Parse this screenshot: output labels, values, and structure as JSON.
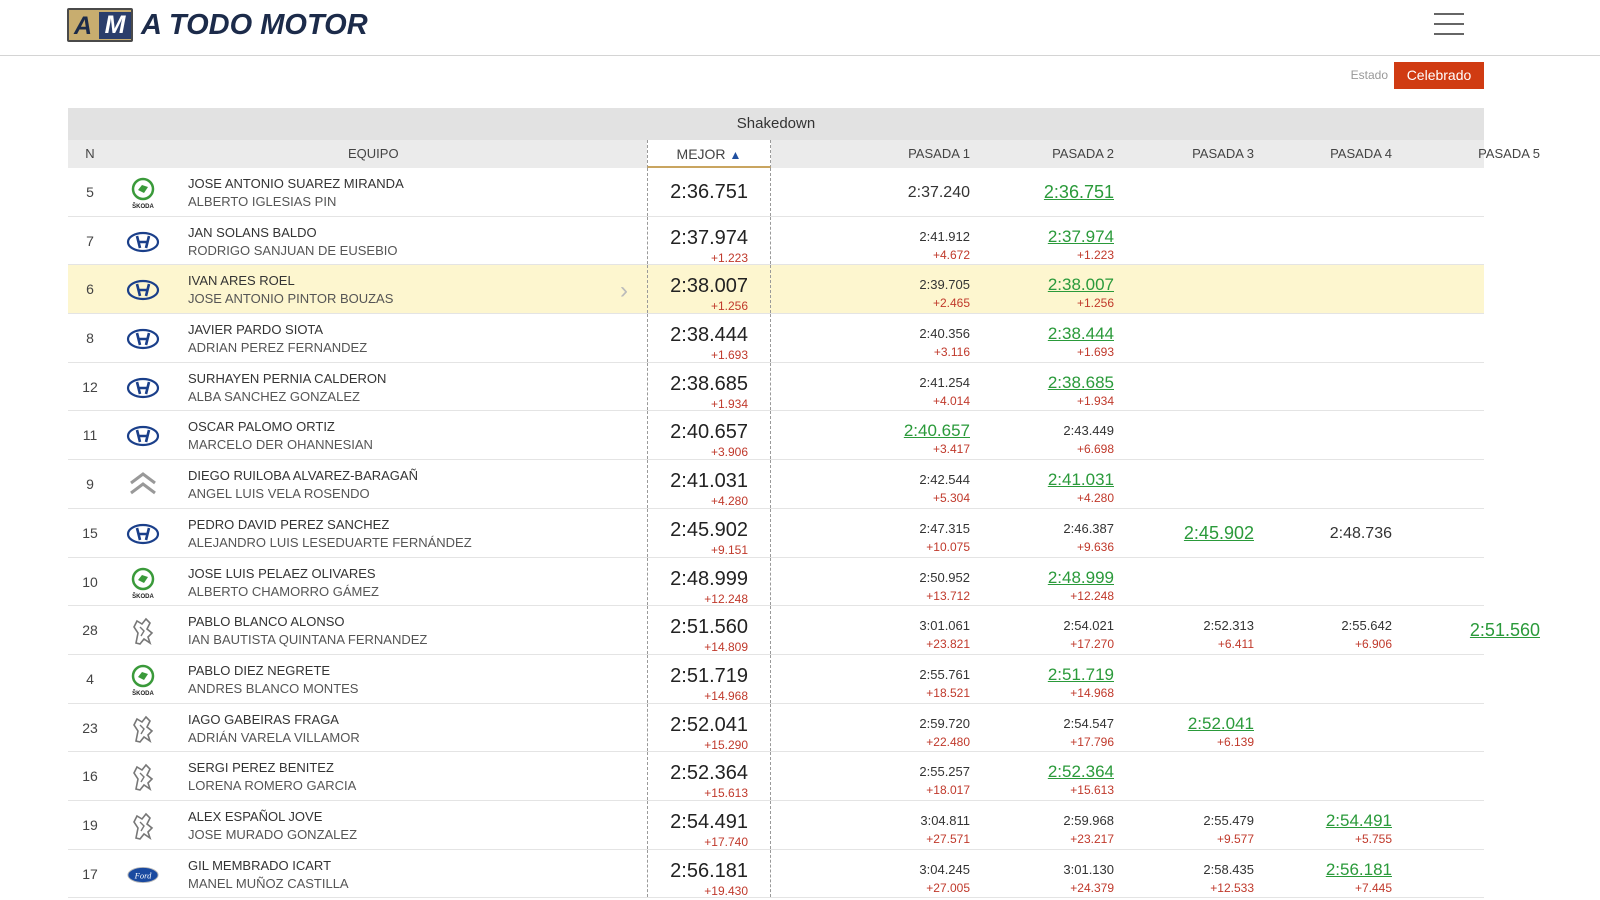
{
  "site": {
    "title": "A TODO MOTOR",
    "badge_a": "A",
    "badge_m": "M"
  },
  "estado": {
    "label": "Estado",
    "value": "Celebrado"
  },
  "section_title": "Shakedown",
  "columns": {
    "n": "N",
    "equipo": "EQUIPO",
    "mejor": "MEJOR",
    "sort_icon": "▲",
    "p1": "PASADA 1",
    "p2": "PASADA 2",
    "p3": "PASADA 3",
    "p4": "PASADA 4",
    "p5": "PASADA 5"
  },
  "brand_colors": {
    "skoda": "#3a9a3a",
    "hyundai": "#1a3f8a",
    "citroen": "#888888",
    "peugeot": "#777777",
    "ford": "#1a4aa0"
  },
  "rows": [
    {
      "n": "5",
      "brand": "skoda-icon",
      "driver": "JOSE ANTONIO SUAREZ MIRANDA",
      "codriver": "ALBERTO IGLESIAS PIN",
      "best": "2:36.751",
      "best_gap": "",
      "p1": {
        "t": "2:37.240",
        "g": ""
      },
      "p2": {
        "t": "2:36.751",
        "g": ""
      },
      "p3": {
        "t": "",
        "g": ""
      },
      "p4": {
        "t": "",
        "g": ""
      },
      "p5": {
        "t": "",
        "g": ""
      }
    },
    {
      "n": "7",
      "brand": "hyundai-icon",
      "driver": "JAN SOLANS BALDO",
      "codriver": "RODRIGO SANJUAN DE EUSEBIO",
      "best": "2:37.974",
      "best_gap": "+1.223",
      "p1": {
        "t": "2:41.912",
        "g": "+4.672"
      },
      "p2": {
        "t": "2:37.974",
        "g": "+1.223"
      },
      "p3": {
        "t": "",
        "g": ""
      },
      "p4": {
        "t": "",
        "g": ""
      },
      "p5": {
        "t": "",
        "g": ""
      }
    },
    {
      "n": "6",
      "brand": "hyundai-icon",
      "driver": "IVAN ARES ROEL",
      "codriver": "JOSE ANTONIO PINTOR BOUZAS",
      "best": "2:38.007",
      "best_gap": "+1.256",
      "p1": {
        "t": "2:39.705",
        "g": "+2.465"
      },
      "p2": {
        "t": "2:38.007",
        "g": "+1.256"
      },
      "p3": {
        "t": "",
        "g": ""
      },
      "p4": {
        "t": "",
        "g": ""
      },
      "p5": {
        "t": "",
        "g": ""
      }
    },
    {
      "n": "8",
      "brand": "hyundai-icon",
      "driver": "JAVIER PARDO SIOTA",
      "codriver": "ADRIAN PEREZ FERNANDEZ",
      "best": "2:38.444",
      "best_gap": "+1.693",
      "p1": {
        "t": "2:40.356",
        "g": "+3.116"
      },
      "p2": {
        "t": "2:38.444",
        "g": "+1.693"
      },
      "p3": {
        "t": "",
        "g": ""
      },
      "p4": {
        "t": "",
        "g": ""
      },
      "p5": {
        "t": "",
        "g": ""
      }
    },
    {
      "n": "12",
      "brand": "hyundai-icon",
      "driver": "SURHAYEN PERNIA CALDERON",
      "codriver": "ALBA SANCHEZ GONZALEZ",
      "best": "2:38.685",
      "best_gap": "+1.934",
      "p1": {
        "t": "2:41.254",
        "g": "+4.014"
      },
      "p2": {
        "t": "2:38.685",
        "g": "+1.934"
      },
      "p3": {
        "t": "",
        "g": ""
      },
      "p4": {
        "t": "",
        "g": ""
      },
      "p5": {
        "t": "",
        "g": ""
      }
    },
    {
      "n": "11",
      "brand": "hyundai-icon",
      "driver": "OSCAR PALOMO ORTIZ",
      "codriver": "MARCELO DER OHANNESIAN",
      "best": "2:40.657",
      "best_gap": "+3.906",
      "p1": {
        "t": "2:40.657",
        "g": "+3.417"
      },
      "p2": {
        "t": "2:43.449",
        "g": "+6.698"
      },
      "p3": {
        "t": "",
        "g": ""
      },
      "p4": {
        "t": "",
        "g": ""
      },
      "p5": {
        "t": "",
        "g": ""
      }
    },
    {
      "n": "9",
      "brand": "citroen-icon",
      "driver": "DIEGO RUILOBA ALVAREZ-BARAGAÑ",
      "codriver": "ANGEL LUIS VELA ROSENDO",
      "best": "2:41.031",
      "best_gap": "+4.280",
      "p1": {
        "t": "2:42.544",
        "g": "+5.304"
      },
      "p2": {
        "t": "2:41.031",
        "g": "+4.280"
      },
      "p3": {
        "t": "",
        "g": ""
      },
      "p4": {
        "t": "",
        "g": ""
      },
      "p5": {
        "t": "",
        "g": ""
      }
    },
    {
      "n": "15",
      "brand": "hyundai-icon",
      "driver": "PEDRO DAVID PEREZ SANCHEZ",
      "codriver": "ALEJANDRO LUIS LESEDUARTE FERNÁNDEZ",
      "best": "2:45.902",
      "best_gap": "+9.151",
      "p1": {
        "t": "2:47.315",
        "g": "+10.075"
      },
      "p2": {
        "t": "2:46.387",
        "g": "+9.636"
      },
      "p3": {
        "t": "2:45.902",
        "g": ""
      },
      "p4": {
        "t": "2:48.736",
        "g": ""
      },
      "p5": {
        "t": "",
        "g": ""
      }
    },
    {
      "n": "10",
      "brand": "skoda-icon",
      "driver": "JOSE LUIS PELAEZ OLIVARES",
      "codriver": "ALBERTO CHAMORRO GÁMEZ",
      "best": "2:48.999",
      "best_gap": "+12.248",
      "p1": {
        "t": "2:50.952",
        "g": "+13.712"
      },
      "p2": {
        "t": "2:48.999",
        "g": "+12.248"
      },
      "p3": {
        "t": "",
        "g": ""
      },
      "p4": {
        "t": "",
        "g": ""
      },
      "p5": {
        "t": "",
        "g": ""
      }
    },
    {
      "n": "28",
      "brand": "peugeot-icon",
      "driver": "PABLO BLANCO ALONSO",
      "codriver": "IAN BAUTISTA QUINTANA FERNANDEZ",
      "best": "2:51.560",
      "best_gap": "+14.809",
      "p1": {
        "t": "3:01.061",
        "g": "+23.821"
      },
      "p2": {
        "t": "2:54.021",
        "g": "+17.270"
      },
      "p3": {
        "t": "2:52.313",
        "g": "+6.411"
      },
      "p4": {
        "t": "2:55.642",
        "g": "+6.906"
      },
      "p5": {
        "t": "2:51.560",
        "g": ""
      }
    },
    {
      "n": "4",
      "brand": "skoda-icon",
      "driver": "PABLO DIEZ NEGRETE",
      "codriver": "ANDRES BLANCO MONTES",
      "best": "2:51.719",
      "best_gap": "+14.968",
      "p1": {
        "t": "2:55.761",
        "g": "+18.521"
      },
      "p2": {
        "t": "2:51.719",
        "g": "+14.968"
      },
      "p3": {
        "t": "",
        "g": ""
      },
      "p4": {
        "t": "",
        "g": ""
      },
      "p5": {
        "t": "",
        "g": ""
      }
    },
    {
      "n": "23",
      "brand": "peugeot-icon",
      "driver": "IAGO GABEIRAS FRAGA",
      "codriver": "ADRIÁN VARELA VILLAMOR",
      "best": "2:52.041",
      "best_gap": "+15.290",
      "p1": {
        "t": "2:59.720",
        "g": "+22.480"
      },
      "p2": {
        "t": "2:54.547",
        "g": "+17.796"
      },
      "p3": {
        "t": "2:52.041",
        "g": "+6.139"
      },
      "p4": {
        "t": "",
        "g": ""
      },
      "p5": {
        "t": "",
        "g": ""
      }
    },
    {
      "n": "16",
      "brand": "peugeot-icon",
      "driver": "SERGI PEREZ BENITEZ",
      "codriver": "LORENA ROMERO GARCIA",
      "best": "2:52.364",
      "best_gap": "+15.613",
      "p1": {
        "t": "2:55.257",
        "g": "+18.017"
      },
      "p2": {
        "t": "2:52.364",
        "g": "+15.613"
      },
      "p3": {
        "t": "",
        "g": ""
      },
      "p4": {
        "t": "",
        "g": ""
      },
      "p5": {
        "t": "",
        "g": ""
      }
    },
    {
      "n": "19",
      "brand": "peugeot-icon",
      "driver": "ALEX ESPAÑOL JOVE",
      "codriver": "JOSE MURADO GONZALEZ",
      "best": "2:54.491",
      "best_gap": "+17.740",
      "p1": {
        "t": "3:04.811",
        "g": "+27.571"
      },
      "p2": {
        "t": "2:59.968",
        "g": "+23.217"
      },
      "p3": {
        "t": "2:55.479",
        "g": "+9.577"
      },
      "p4": {
        "t": "2:54.491",
        "g": "+5.755"
      },
      "p5": {
        "t": "",
        "g": ""
      }
    },
    {
      "n": "17",
      "brand": "ford-icon",
      "driver": "GIL MEMBRADO ICART",
      "codriver": "MANEL MUÑOZ CASTILLA",
      "best": "2:56.181",
      "best_gap": "+19.430",
      "p1": {
        "t": "3:04.245",
        "g": "+27.005"
      },
      "p2": {
        "t": "3:01.130",
        "g": "+24.379"
      },
      "p3": {
        "t": "2:58.435",
        "g": "+12.533"
      },
      "p4": {
        "t": "2:56.181",
        "g": "+7.445"
      },
      "p5": {
        "t": "",
        "g": ""
      }
    }
  ]
}
